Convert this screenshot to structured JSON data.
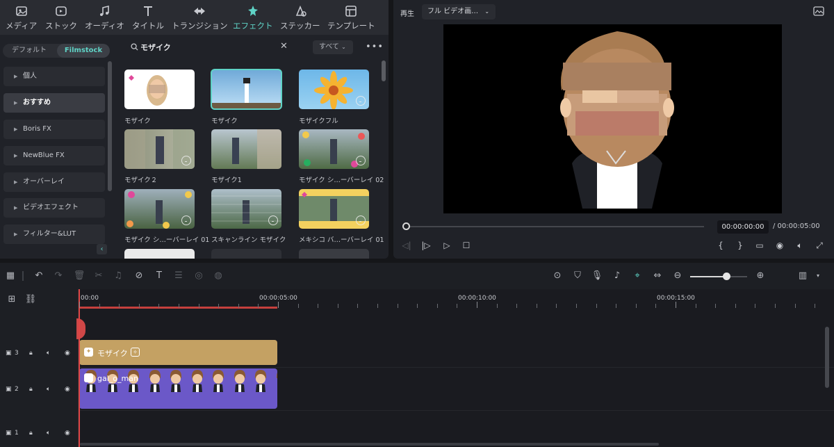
{
  "library": {
    "tabs": [
      {
        "label": "メディア",
        "icon": "media-icon"
      },
      {
        "label": "ストック",
        "icon": "stock-icon"
      },
      {
        "label": "オーディオ",
        "icon": "music-note-icon"
      },
      {
        "label": "タイトル",
        "icon": "title-icon"
      },
      {
        "label": "トランジション",
        "icon": "transition-icon"
      },
      {
        "label": "エフェクト",
        "icon": "effects-icon",
        "active": true
      },
      {
        "label": "ステッカー",
        "icon": "sticker-icon"
      },
      {
        "label": "テンプレート",
        "icon": "template-icon"
      }
    ],
    "segment": {
      "default": "デフォルト",
      "filmstock": "Filmstock"
    },
    "categories": [
      {
        "label": "個人"
      },
      {
        "label": "おすすめ",
        "selected": true
      },
      {
        "label": "Boris FX"
      },
      {
        "label": "NewBlue FX"
      },
      {
        "label": "オーバーレイ"
      },
      {
        "label": "ビデオエフェクト"
      },
      {
        "label": "フィルター&LUT"
      }
    ],
    "search": {
      "query": "モザイク",
      "icon": "search-icon",
      "clear_icon": "close-icon"
    },
    "filter_label": "すべて",
    "more_icon": "more-icon",
    "results": [
      {
        "label": "モザイク"
      },
      {
        "label": "モザイク",
        "selected": true
      },
      {
        "label": "モザイクフル",
        "download": true
      },
      {
        "label": "モザイク２",
        "download": true
      },
      {
        "label": "モザイク1"
      },
      {
        "label": "モザイク シ…ーバーレイ 02",
        "download": true
      },
      {
        "label": "モザイク シ…ーバーレイ 01",
        "download": true
      },
      {
        "label": "スキャンライン モザイク",
        "download": true
      },
      {
        "label": "メキシコ バ…ーバーレイ 01",
        "download": true
      }
    ]
  },
  "preview": {
    "label": "再生",
    "quality": "フル ビデオ画…",
    "current_time": "00:00:00:00",
    "total_time": "/ 00:00:05:00",
    "progress": 0
  },
  "toolbar": {
    "icons": [
      "layout-icon",
      "undo-icon",
      "redo-icon",
      "delete-icon",
      "cut-icon",
      "audio-icon",
      "tag-icon",
      "text-icon",
      "adjust-icon",
      "color-icon",
      "speed-icon"
    ],
    "right_icons": [
      "render-icon",
      "marker-icon",
      "mic-icon",
      "music-icon",
      "snap-icon",
      "fit-icon",
      "zoom-out-icon",
      "zoom-in-icon",
      "track-height-icon"
    ],
    "zoom_level": 0.6
  },
  "timeline": {
    "ruler": [
      "00:00",
      "00:00:05:00",
      "00:00:10:00",
      "00:00:15:00"
    ],
    "tracks": [
      {
        "number": "3"
      },
      {
        "number": "2"
      },
      {
        "number": "1"
      }
    ],
    "clip_effect": "モザイク",
    "clip_video": "gal_o_man"
  },
  "colors": {
    "accent": "#5fd3c6",
    "effect_clip": "#c4a163",
    "video_clip": "#6b58c8",
    "playhead": "#e04545"
  }
}
